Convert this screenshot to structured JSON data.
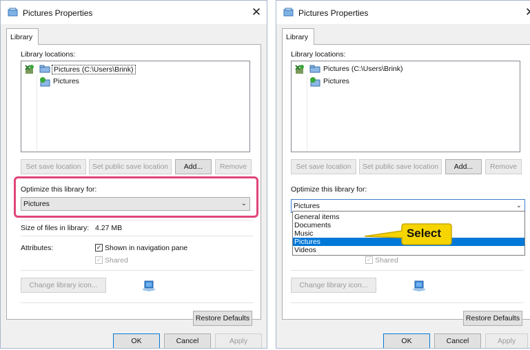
{
  "dialog_title": "Pictures Properties",
  "close_glyph": "✕",
  "tab_label": "Library",
  "library_locations_label": "Library locations:",
  "locations": [
    {
      "label": "Pictures (C:\\Users\\Brink)",
      "icon": "default-save-location-icon"
    },
    {
      "label": "Pictures",
      "icon": "public-save-location-icon"
    }
  ],
  "buttons": {
    "set_save_location": "Set save location",
    "set_public_save_location": "Set public save location",
    "add": "Add...",
    "remove": "Remove",
    "change_library_icon": "Change library icon...",
    "restore_defaults": "Restore Defaults",
    "ok": "OK",
    "cancel": "Cancel",
    "apply": "Apply"
  },
  "optimize_label": "Optimize this library for:",
  "optimize_value": "Pictures",
  "optimize_options": [
    "General items",
    "Documents",
    "Music",
    "Pictures",
    "Videos"
  ],
  "selected_option": "Pictures",
  "size_label": "Size of files in library:",
  "size_value": "4.27 MB",
  "attributes_label": "Attributes:",
  "shown_in_nav_label": "Shown in navigation pane",
  "shared_label": "Shared",
  "check_glyph": "✓",
  "callout_text": "Select",
  "colors": {
    "highlight": "#e0457a",
    "selection": "#0078d7",
    "callout_fill": "#f5d400"
  }
}
